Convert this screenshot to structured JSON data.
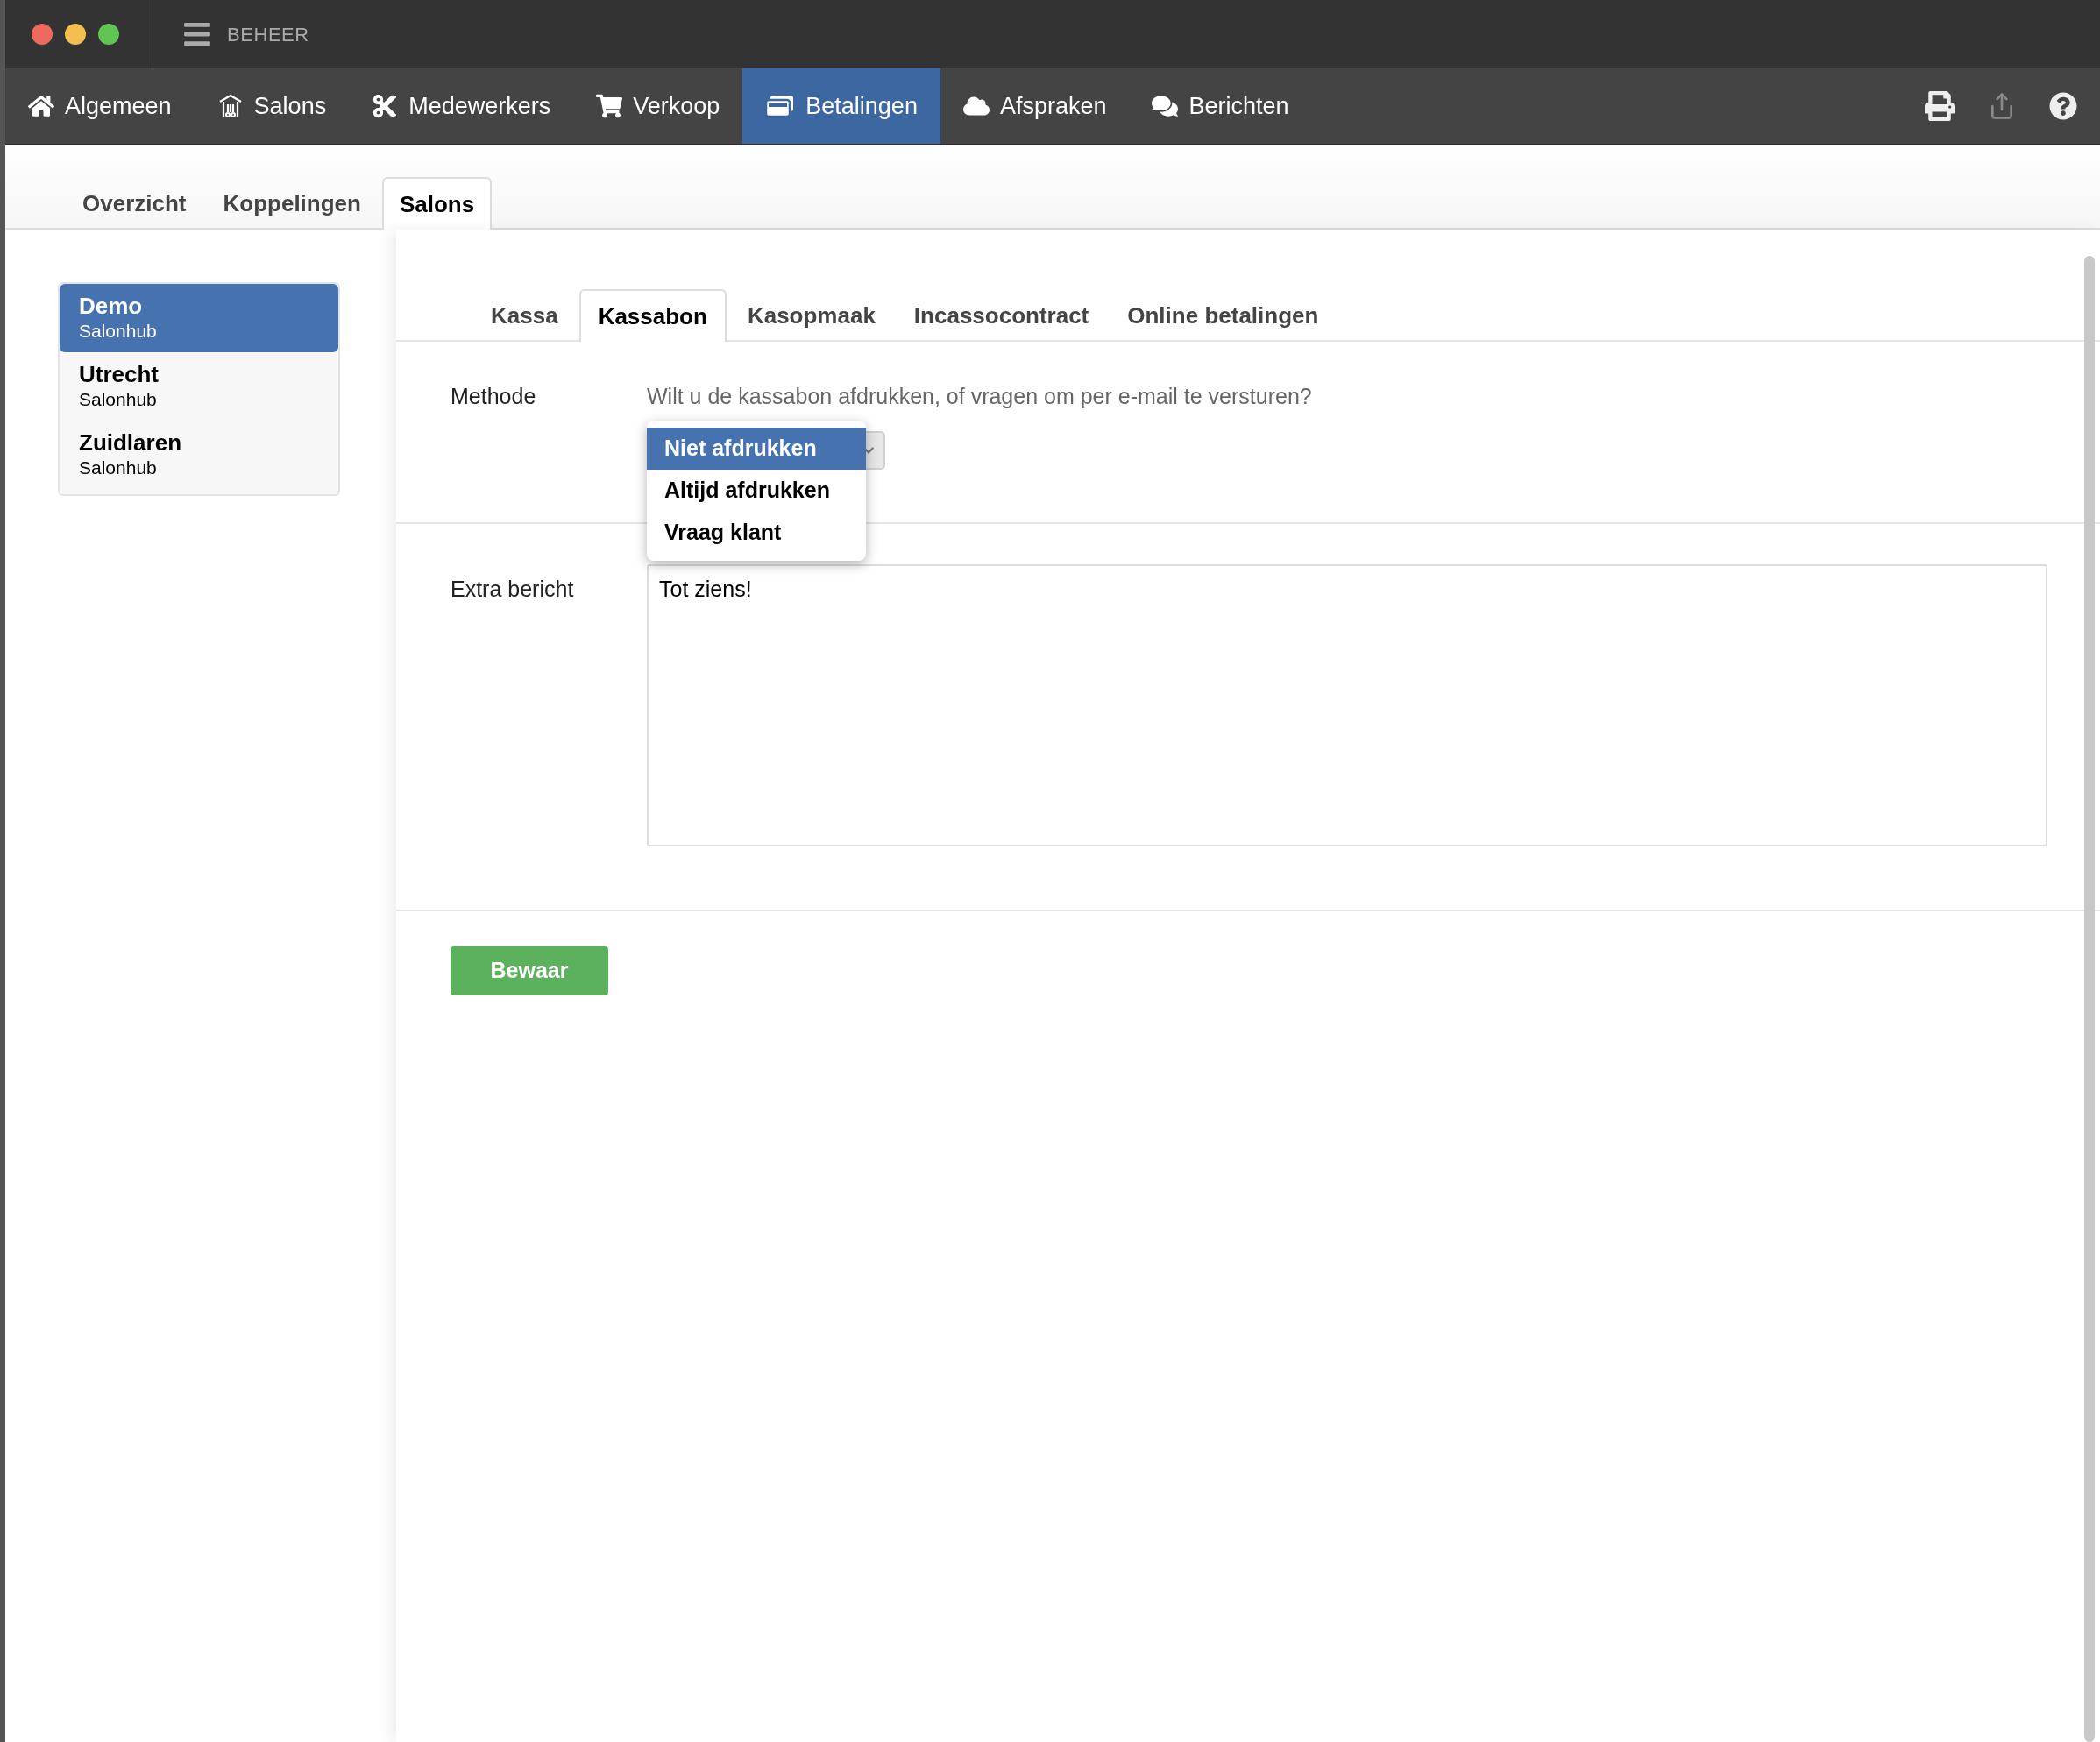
{
  "window": {
    "title": "BEHEER"
  },
  "nav": [
    {
      "kind": "home",
      "label": "Algemeen",
      "selected": false
    },
    {
      "kind": "salon",
      "label": "Salons",
      "selected": false
    },
    {
      "kind": "scissors",
      "label": "Medewerkers",
      "selected": false
    },
    {
      "kind": "cart",
      "label": "Verkoop",
      "selected": false
    },
    {
      "kind": "payments",
      "label": "Betalingen",
      "selected": true
    },
    {
      "kind": "cloud",
      "label": "Afspraken",
      "selected": false
    },
    {
      "kind": "chat",
      "label": "Berichten",
      "selected": false
    }
  ],
  "toolbar": [
    {
      "kind": "print",
      "disabled": false
    },
    {
      "kind": "share",
      "disabled": true
    },
    {
      "kind": "help",
      "disabled": false
    }
  ],
  "sub_tabs": [
    {
      "label": "Overzicht",
      "selected": false
    },
    {
      "label": "Koppelingen",
      "selected": false
    },
    {
      "label": "Salons",
      "selected": true
    }
  ],
  "salons": [
    {
      "name": "Demo",
      "subtitle": "Salonhub",
      "selected": true
    },
    {
      "name": "Utrecht",
      "subtitle": "Salonhub",
      "selected": false
    },
    {
      "name": "Zuidlaren",
      "subtitle": "Salonhub",
      "selected": false
    }
  ],
  "inner_tabs": [
    {
      "label": "Kassa",
      "selected": false
    },
    {
      "label": "Kassabon",
      "selected": true
    },
    {
      "label": "Kasopmaak",
      "selected": false
    },
    {
      "label": "Incassocontract",
      "selected": false
    },
    {
      "label": "Online betalingen",
      "selected": false
    }
  ],
  "form": {
    "method": {
      "label": "Methode",
      "hint": "Wilt u de kassabon afdrukken, of vragen om per e-mail te versturen?",
      "options": [
        {
          "label": "Niet afdrukken",
          "selected": true
        },
        {
          "label": "Altijd afdrukken",
          "selected": false
        },
        {
          "label": "Vraag klant",
          "selected": false
        }
      ]
    },
    "extra": {
      "label": "Extra bericht",
      "value": "Tot ziens!"
    },
    "save_button": "Bewaar"
  }
}
